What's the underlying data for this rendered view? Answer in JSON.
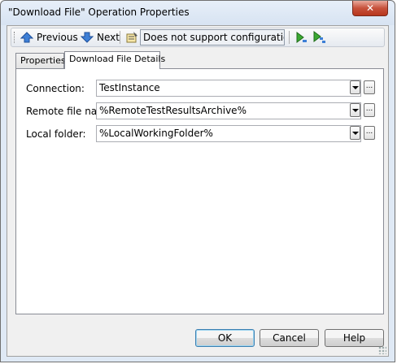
{
  "window": {
    "title": "\"Download File\" Operation Properties",
    "close_glyph": "✕"
  },
  "toolbar": {
    "previous_label": "Previous",
    "next_label": "Next",
    "status_text": "Does not support configurations.",
    "icons": [
      "up-arrow-icon",
      "down-arrow-icon",
      "properties-icon",
      "run-icon",
      "run-step-icon"
    ]
  },
  "tabs": [
    {
      "label": "Properties",
      "active": false
    },
    {
      "label": "Download File Details",
      "active": true
    }
  ],
  "fields": [
    {
      "label": "Connection:",
      "value": "TestInstance"
    },
    {
      "label": "Remote file name:",
      "value": "%RemoteTestResultsArchive%"
    },
    {
      "label": "Local folder:",
      "value": "%LocalWorkingFolder%"
    }
  ],
  "ellipsis_glyph": "...",
  "buttons": {
    "ok": "OK",
    "cancel": "Cancel",
    "help": "Help"
  },
  "colors": {
    "close_button": "#c7523c",
    "arrow_blue": "#2f6fc7",
    "run_green": "#3aa832"
  }
}
